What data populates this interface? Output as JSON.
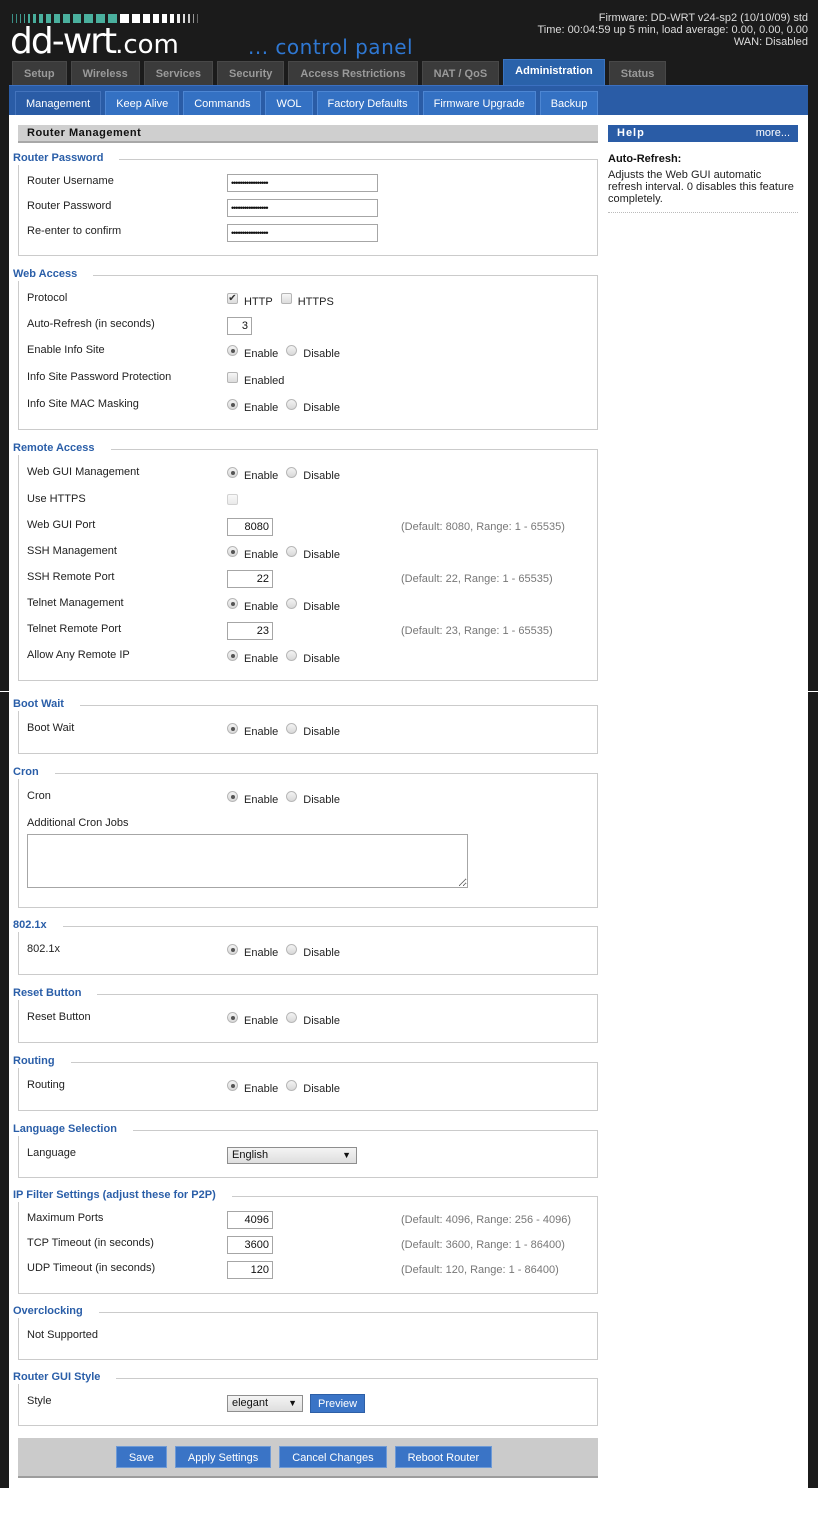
{
  "header": {
    "logo_main": "dd-wrt",
    "logo_com": ".com",
    "logo_sub": "... control panel",
    "firmware": "Firmware: DD-WRT v24-sp2 (10/10/09) std",
    "time": "Time: 00:04:59 up 5 min, load average: 0.00, 0.00, 0.00",
    "wan": "WAN: Disabled"
  },
  "main_tabs": [
    {
      "label": "Setup",
      "active": false
    },
    {
      "label": "Wireless",
      "active": false
    },
    {
      "label": "Services",
      "active": false
    },
    {
      "label": "Security",
      "active": false
    },
    {
      "label": "Access Restrictions",
      "active": false
    },
    {
      "label": "NAT / QoS",
      "active": false
    },
    {
      "label": "Administration",
      "active": true
    },
    {
      "label": "Status",
      "active": false
    }
  ],
  "sub_tabs": [
    {
      "label": "Management",
      "active": true
    },
    {
      "label": "Keep Alive",
      "active": false
    },
    {
      "label": "Commands",
      "active": false
    },
    {
      "label": "WOL",
      "active": false
    },
    {
      "label": "Factory Defaults",
      "active": false
    },
    {
      "label": "Firmware Upgrade",
      "active": false
    },
    {
      "label": "Backup",
      "active": false
    }
  ],
  "section_title": "Router Management",
  "common": {
    "enable": "Enable",
    "disable": "Disable"
  },
  "router_password": {
    "legend": "Router Password",
    "username_label": "Router Username",
    "username_value": "•••••••••••••••••",
    "password_label": "Router Password",
    "password_value": "•••••••••••••••••",
    "confirm_label": "Re-enter to confirm",
    "confirm_value": "•••••••••••••••••"
  },
  "web_access": {
    "legend": "Web Access",
    "protocol_label": "Protocol",
    "http_label": "HTTP",
    "http_checked": true,
    "https_label": "HTTPS",
    "https_checked": false,
    "autorefresh_label": "Auto-Refresh (in seconds)",
    "autorefresh_value": "3",
    "info_site_label": "Enable Info Site",
    "info_site": "enable",
    "info_pw_label": "Info Site Password Protection",
    "info_pw_option": "Enabled",
    "info_pw_checked": false,
    "mac_mask_label": "Info Site MAC Masking",
    "mac_mask": "enable"
  },
  "remote_access": {
    "legend": "Remote Access",
    "webgui_label": "Web GUI Management",
    "webgui": "enable",
    "use_https_label": "Use HTTPS",
    "use_https_checked": false,
    "webgui_port_label": "Web GUI Port",
    "webgui_port_value": "8080",
    "webgui_port_hint": "(Default: 8080, Range: 1 - 65535)",
    "ssh_label": "SSH Management",
    "ssh": "enable",
    "ssh_port_label": "SSH Remote Port",
    "ssh_port_value": "22",
    "ssh_port_hint": "(Default: 22, Range: 1 - 65535)",
    "telnet_label": "Telnet Management",
    "telnet": "enable",
    "telnet_port_label": "Telnet Remote Port",
    "telnet_port_value": "23",
    "telnet_port_hint": "(Default: 23, Range: 1 - 65535)",
    "any_ip_label": "Allow Any Remote IP",
    "any_ip": "enable"
  },
  "boot_wait": {
    "legend": "Boot Wait",
    "label": "Boot Wait",
    "value": "enable"
  },
  "cron": {
    "legend": "Cron",
    "label": "Cron",
    "value": "enable",
    "jobs_label": "Additional Cron Jobs",
    "jobs_value": ""
  },
  "dot1x": {
    "legend": "802.1x",
    "label": "802.1x",
    "value": "enable"
  },
  "reset_button": {
    "legend": "Reset Button",
    "label": "Reset Button",
    "value": "enable"
  },
  "routing": {
    "legend": "Routing",
    "label": "Routing",
    "value": "enable"
  },
  "language": {
    "legend": "Language Selection",
    "label": "Language",
    "selected": "English"
  },
  "ip_filter": {
    "legend": "IP Filter Settings (adjust these for P2P)",
    "max_ports_label": "Maximum Ports",
    "max_ports_value": "4096",
    "max_ports_hint": "(Default: 4096, Range: 256 - 4096)",
    "tcp_label": "TCP Timeout (in seconds)",
    "tcp_value": "3600",
    "tcp_hint": "(Default: 3600, Range: 1 - 86400)",
    "udp_label": "UDP Timeout (in seconds)",
    "udp_value": "120",
    "udp_hint": "(Default: 120, Range: 1 - 86400)"
  },
  "overclocking": {
    "legend": "Overclocking",
    "text": "Not Supported"
  },
  "gui_style": {
    "legend": "Router GUI Style",
    "label": "Style",
    "selected": "elegant",
    "preview_label": "Preview"
  },
  "help": {
    "title": "Help",
    "more": "more...",
    "term": "Auto-Refresh:",
    "description": "Adjusts the Web GUI automatic refresh interval. 0 disables this feature completely."
  },
  "footer": {
    "save": "Save",
    "apply": "Apply Settings",
    "cancel": "Cancel Changes",
    "reboot": "Reboot Router"
  },
  "colors": {
    "accent_blue": "#2a5ca6",
    "button_blue": "#3a74c6",
    "legend_blue": "#2a5ea8",
    "frame_dark": "#1b1b1b"
  }
}
